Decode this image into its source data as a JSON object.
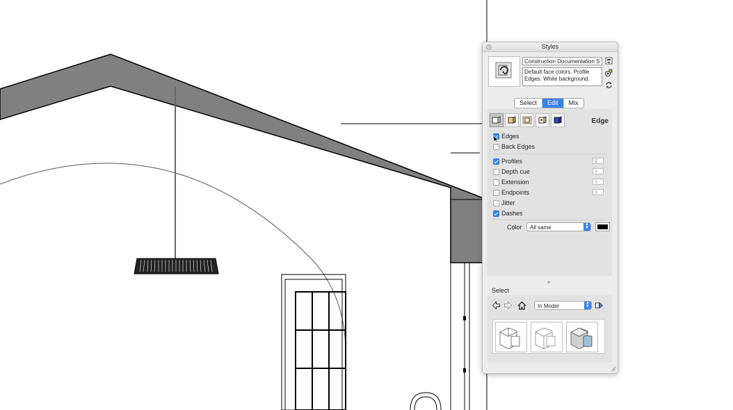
{
  "panel": {
    "title": "Styles",
    "style_name": "Construction Documentation S",
    "style_description": "Default face colors. Profile Edges. White background.",
    "tabs": [
      {
        "label": "Select",
        "active": false
      },
      {
        "label": "Edit",
        "active": true
      },
      {
        "label": "Mix",
        "active": false
      }
    ],
    "edit": {
      "section": "Edge",
      "categories": [
        "edge-settings-icon",
        "face-settings-icon",
        "background-settings-icon",
        "watermark-settings-icon",
        "modeling-settings-icon"
      ],
      "edges": {
        "label": "Edges",
        "checked": true
      },
      "back_edges": {
        "label": "Back Edges",
        "checked": false
      },
      "profiles": {
        "label": "Profiles",
        "checked": true,
        "value": "1"
      },
      "depth_cue": {
        "label": "Depth cue",
        "checked": false,
        "value": "4"
      },
      "extension": {
        "label": "Extension",
        "checked": false,
        "value": "3"
      },
      "endpoints": {
        "label": "Endpoints",
        "checked": false,
        "value": "9"
      },
      "jitter": {
        "label": "Jitter",
        "checked": false
      },
      "dashes": {
        "label": "Dashes",
        "checked": true
      },
      "color_label": "Color",
      "color_mode": "All same",
      "edge_color": "#000000"
    },
    "select": {
      "label": "Select",
      "collection": "In Model",
      "thumbnails": [
        "style-thumb-construction-docs",
        "style-thumb-default",
        "style-thumb-shaded"
      ]
    },
    "accent_color": "#3b82e8"
  }
}
